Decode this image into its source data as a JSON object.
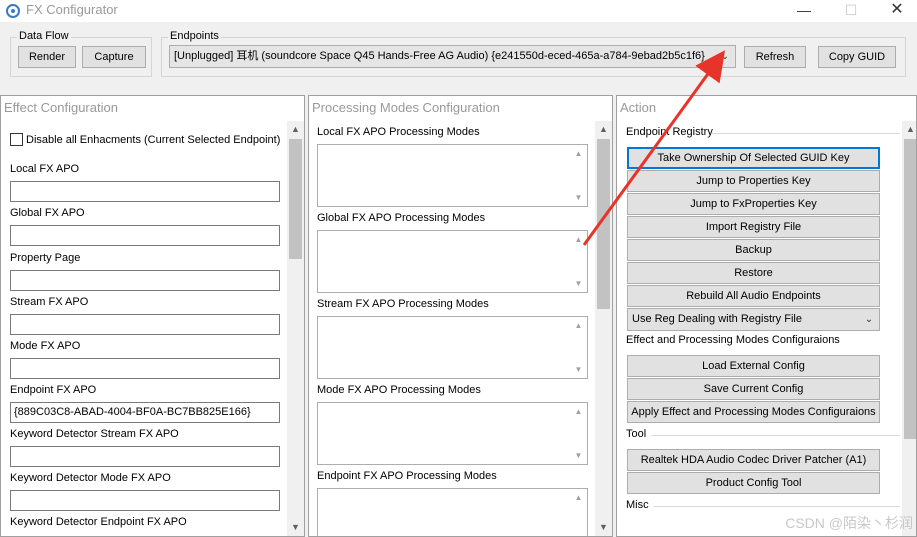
{
  "window": {
    "title": "FX Configurator",
    "minimize": "—",
    "maximize": "☐",
    "close": "✕"
  },
  "data_flow": {
    "label": "Data Flow",
    "render": "Render",
    "capture": "Capture"
  },
  "endpoints": {
    "label": "Endpoints",
    "selected": "[Unplugged] 耳机 (soundcore Space Q45 Hands-Free AG Audio) {e241550d-eced-465a-a784-9ebad2b5c1f6}",
    "refresh": "Refresh",
    "copy_guid": "Copy GUID"
  },
  "effect_config": {
    "title": "Effect Configuration",
    "disable_all": "Disable all Enhacments (Current Selected Endpoint)",
    "fields": [
      {
        "label": "Local FX APO",
        "value": ""
      },
      {
        "label": "Global FX APO",
        "value": ""
      },
      {
        "label": "Property Page",
        "value": ""
      },
      {
        "label": "Stream FX APO",
        "value": ""
      },
      {
        "label": "Mode FX APO",
        "value": ""
      },
      {
        "label": "Endpoint FX APO",
        "value": "{889C03C8-ABAD-4004-BF0A-BC7BB825E166}"
      },
      {
        "label": "Keyword Detector Stream FX APO",
        "value": ""
      },
      {
        "label": "Keyword Detector Mode FX APO",
        "value": ""
      },
      {
        "label": "Keyword Detector Endpoint FX APO",
        "value": ""
      }
    ]
  },
  "processing_modes": {
    "title": "Processing Modes Configuration",
    "sections": [
      {
        "label": "Local FX APO Processing Modes"
      },
      {
        "label": "Global FX APO Processing Modes"
      },
      {
        "label": "Stream FX APO Processing Modes"
      },
      {
        "label": "Mode FX APO Processing Modes"
      },
      {
        "label": "Endpoint FX APO Processing Modes"
      }
    ]
  },
  "action": {
    "title": "Action",
    "endpoint_registry": "Endpoint Registry",
    "buttons": [
      "Take Ownership Of Selected GUID Key",
      "Jump to Properties Key",
      "Jump to FxProperties Key",
      "Import Registry File",
      "Backup",
      "Restore",
      "Rebuild All Audio Endpoints"
    ],
    "reg_dealing": "Use Reg Dealing with Registry File",
    "effect_section": "Effect and Processing Modes Configuraions",
    "effect_buttons": [
      "Load External Config",
      "Save Current Config",
      "Apply Effect and Processing Modes Configuraions"
    ],
    "tool_section": "Tool",
    "tool_buttons": [
      "Realtek HDA Audio Codec Driver Patcher (A1)",
      "Product Config Tool"
    ],
    "misc_section": "Misc"
  },
  "watermark": "CSDN @陌染丶杉润",
  "colors": {
    "accent": "#0078d7",
    "annotation_arrow": "#e8332a"
  }
}
